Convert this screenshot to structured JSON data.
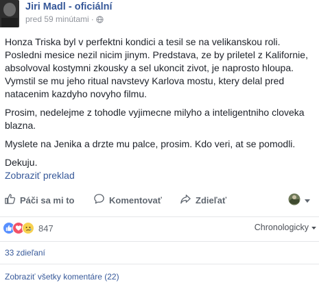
{
  "header": {
    "author": "Jiri Madl - oficiální",
    "time": "pred 59 minútami",
    "separator": "·"
  },
  "post": {
    "paragraphs": [
      "Honza Triska byl v perfektni kondici a tesil se na velikanskou roli. Posledni mesice nezil nicim jinym. Predstava, ze by priletel z Kalifornie, absolvoval kostymni zkousky a sel ukoncit zivot, je naprosto hloupa. Vymstil se mu jeho ritual navstevy Karlova mostu, ktery delal pred natacenim kazdyho novyho filmu.",
      "Prosim, nedelejme z tohodle vyjimecne milyho a inteligentniho cloveka blazna.",
      "Myslete na Jenika a drzte mu palce, prosim. Kdo veri, at se pomodli.",
      "Dekuju."
    ],
    "translate_link": "Zobraziť preklad"
  },
  "actions": {
    "like": "Páči sa mi to",
    "comment": "Komentovať",
    "share": "Zdieľať"
  },
  "reactions": {
    "count": "847",
    "sort_label": "Chronologicky"
  },
  "footer": {
    "shares": "33 zdieľaní",
    "view_comments": "Zobraziť všetky komentáre (22)"
  },
  "colors": {
    "link": "#365899",
    "like_blue": "#5890ff",
    "love_red": "#f25268",
    "sad_yellow": "#f7d14f"
  }
}
